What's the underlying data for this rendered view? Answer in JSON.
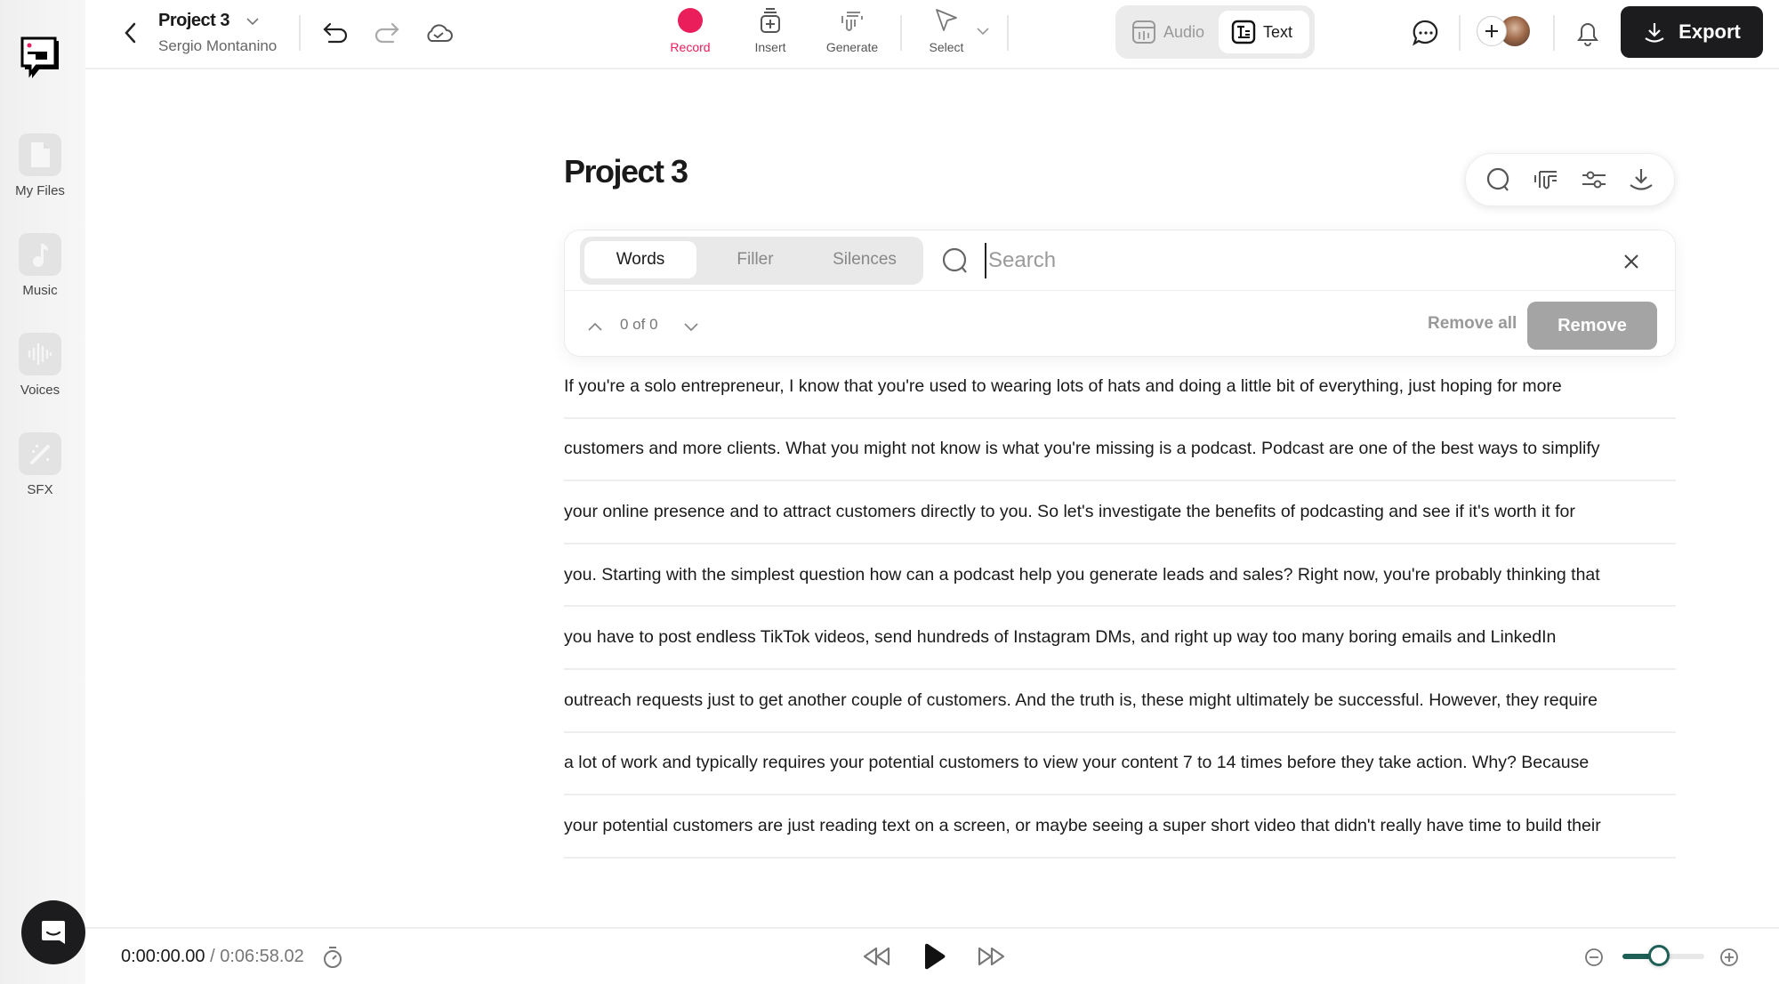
{
  "header": {
    "project_name": "Project 3",
    "owner": "Sergio Montanino",
    "tools": [
      {
        "label": "Record",
        "icon": "record-icon",
        "color": "#e91e5a"
      },
      {
        "label": "Insert",
        "icon": "insert-icon"
      },
      {
        "label": "Generate",
        "icon": "generate-icon"
      },
      {
        "label": "Select",
        "icon": "cursor-icon"
      }
    ],
    "modes": [
      {
        "label": "Audio",
        "active": false
      },
      {
        "label": "Text",
        "active": true
      }
    ],
    "export_label": "Export"
  },
  "sidebar": {
    "items": [
      {
        "label": "My Files",
        "icon": "file-icon"
      },
      {
        "label": "Music",
        "icon": "music-note-icon"
      },
      {
        "label": "Voices",
        "icon": "waveform-icon"
      },
      {
        "label": "SFX",
        "icon": "magic-wand-icon"
      }
    ]
  },
  "main": {
    "title": "Project 3",
    "search": {
      "tabs": [
        {
          "label": "Words",
          "active": true
        },
        {
          "label": "Filler",
          "active": false
        },
        {
          "label": "Silences",
          "active": false
        }
      ],
      "placeholder": "Search",
      "value": "",
      "count": "0 of 0",
      "remove_all_label": "Remove all",
      "remove_label": "Remove"
    },
    "transcript_lines": [
      "If you're a solo entrepreneur, I know that you're used to wearing lots of hats and doing a little bit of everything, just hoping for more",
      "customers and more clients. What you might not know is what you're missing is a podcast. Podcast are one of the best ways to simplify",
      "your online presence and to attract customers directly to you. So let's investigate the benefits of podcasting and see if it's worth it for",
      "you. Starting with the simplest question how can a podcast help you generate leads and sales? Right now, you're probably thinking that",
      "you have to post endless TikTok videos, send hundreds of Instagram DMs, and right up way too many boring emails and LinkedIn",
      "outreach requests just to get another couple of customers. And the truth is, these might ultimately be successful. However, they require",
      "a lot of work and typically requires your potential customers to view your content 7 to 14 times before they take action. Why? Because",
      "your potential customers are just reading text on a screen, or maybe seeing a super short video that didn't really have time to build their"
    ]
  },
  "player": {
    "current_time": "0:00:00.00",
    "separator": " / ",
    "total_time": "0:06:58.02",
    "zoom_level": 0.45,
    "accent_color": "#1e5f56"
  }
}
